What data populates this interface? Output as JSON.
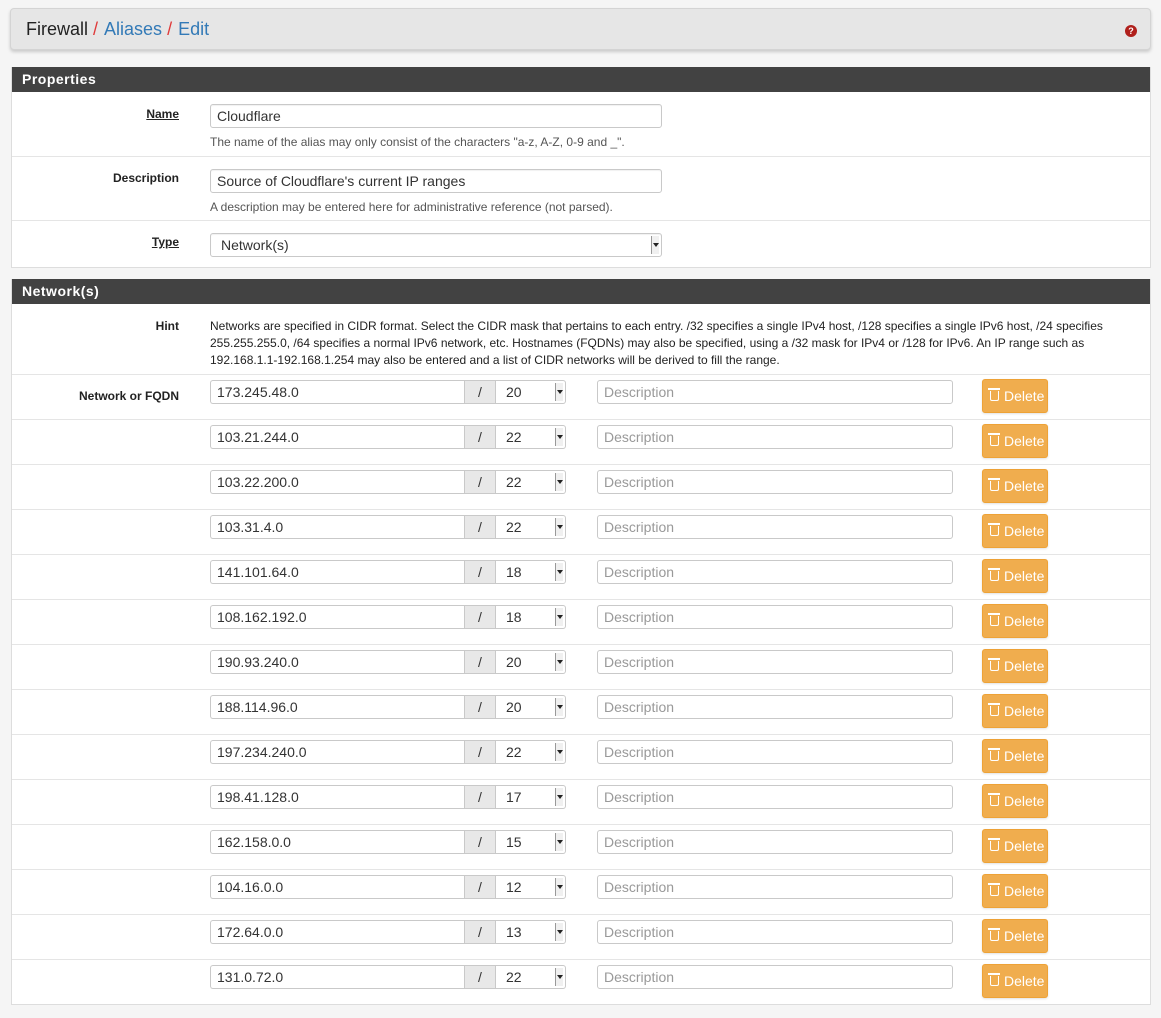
{
  "breadcrumb": {
    "items": [
      "Firewall",
      "Aliases",
      "Edit"
    ],
    "separator": "/"
  },
  "help_icon": "question-circle-icon",
  "properties": {
    "heading": "Properties",
    "name": {
      "label": "Name",
      "value": "Cloudflare",
      "help": "The name of the alias may only consist of the characters \"a-z, A-Z, 0-9 and _\"."
    },
    "description": {
      "label": "Description",
      "value": "Source of Cloudflare's current IP ranges",
      "help": "A description may be entered here for administrative reference (not parsed)."
    },
    "type": {
      "label": "Type",
      "value": "Network(s)"
    }
  },
  "networks": {
    "heading": "Network(s)",
    "hint_label": "Hint",
    "hint_line1": "Networks are specified in CIDR format. Select the CIDR mask that pertains to each entry. /32 specifies a single IPv4 host, /128 specifies a single IPv6 host, /24 specifies",
    "hint_line2": "255.255.255.0, /64 specifies a normal IPv6 network, etc. Hostnames (FQDNs) may also be specified, using a /32 mask for IPv4 or /128 for IPv6. An IP range such as",
    "hint_line3": "192.168.1.1-192.168.1.254 may also be entered and a list of CIDR networks will be derived to fill the range.",
    "row_label": "Network or FQDN",
    "slash": "/",
    "desc_placeholder": "Description",
    "delete_label": "Delete",
    "entries": [
      {
        "address": "173.245.48.0",
        "mask": "20"
      },
      {
        "address": "103.21.244.0",
        "mask": "22"
      },
      {
        "address": "103.22.200.0",
        "mask": "22"
      },
      {
        "address": "103.31.4.0",
        "mask": "22"
      },
      {
        "address": "141.101.64.0",
        "mask": "18"
      },
      {
        "address": "108.162.192.0",
        "mask": "18"
      },
      {
        "address": "190.93.240.0",
        "mask": "20"
      },
      {
        "address": "188.114.96.0",
        "mask": "20"
      },
      {
        "address": "197.234.240.0",
        "mask": "22"
      },
      {
        "address": "198.41.128.0",
        "mask": "17"
      },
      {
        "address": "162.158.0.0",
        "mask": "15"
      },
      {
        "address": "104.16.0.0",
        "mask": "12"
      },
      {
        "address": "172.64.0.0",
        "mask": "13"
      },
      {
        "address": "131.0.72.0",
        "mask": "22"
      }
    ]
  },
  "colors": {
    "accent_link": "#337ab7",
    "separator": "#e03a3a",
    "panel_heading": "#424242",
    "delete_button": "#f0ad4e"
  }
}
